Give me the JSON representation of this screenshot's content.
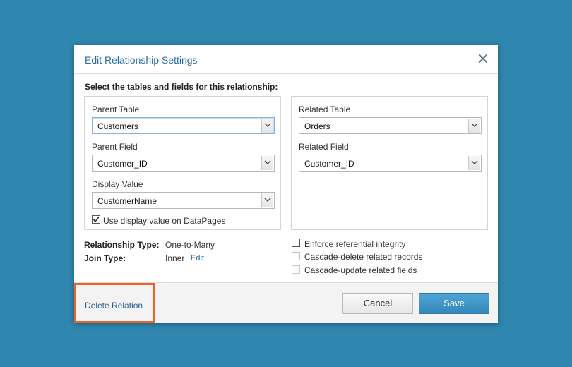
{
  "dialog": {
    "title": "Edit Relationship Settings",
    "close_icon": "close-icon",
    "instruction": "Select the tables and fields for this relationship:"
  },
  "parent": {
    "table_label": "Parent Table",
    "table_value": "Customers",
    "field_label": "Parent Field",
    "field_value": "Customer_ID",
    "display_label": "Display Value",
    "display_value": "CustomerName",
    "use_display_label": "Use display value on DataPages",
    "use_display_checked": true
  },
  "related": {
    "table_label": "Related Table",
    "table_value": "Orders",
    "field_label": "Related Field",
    "field_value": "Customer_ID"
  },
  "info": {
    "relationship_type_label": "Relationship Type:",
    "relationship_type_value": "One-to-Many",
    "join_type_label": "Join Type:",
    "join_type_value": "Inner",
    "edit_link": "Edit"
  },
  "options": {
    "enforce_label": "Enforce referential integrity",
    "enforce_checked": false,
    "cascade_delete_label": "Cascade-delete related records",
    "cascade_delete_checked": false,
    "cascade_update_label": "Cascade-update related fields",
    "cascade_update_checked": false
  },
  "footer": {
    "delete_label": "Delete Relation",
    "cancel_label": "Cancel",
    "save_label": "Save"
  },
  "colors": {
    "background": "#2f86af",
    "accent": "#2a6ea6",
    "highlight_border": "#e8622a",
    "save_button": "#3d95c6"
  }
}
